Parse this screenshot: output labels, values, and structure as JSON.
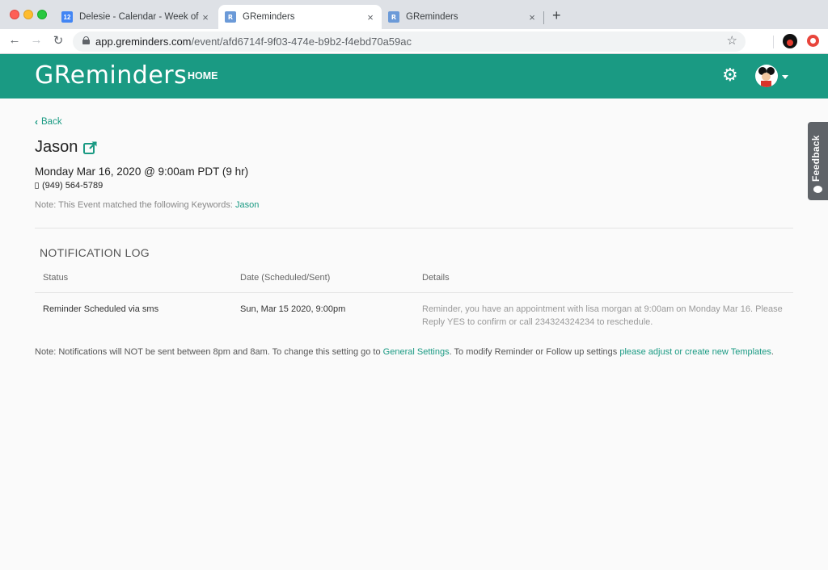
{
  "browser": {
    "tabs": [
      {
        "title": "Delesie - Calendar - Week of Ma",
        "favicon": "calendar-icon",
        "favicon_text": "12",
        "active": false
      },
      {
        "title": "GReminders",
        "favicon": "greminders-icon",
        "favicon_text": "R",
        "active": true
      },
      {
        "title": "GReminders",
        "favicon": "greminders-icon",
        "favicon_text": "R",
        "active": false
      }
    ],
    "new_tab_label": "+",
    "close_glyph": "×",
    "url_host": "app.greminders.com",
    "url_path": "/event/afd6714f-9f03-474e-b9b2-f4ebd70a59ac"
  },
  "header": {
    "brand": "GReminders",
    "nav_home": "HOME",
    "accent_color": "#1a9a83"
  },
  "event": {
    "back_label": "Back",
    "title": "Jason",
    "datetime": "Monday Mar 16, 2020 @ 9:00am PDT (9 hr)",
    "phone": "(949) 564-5789",
    "keywords_note": "Note: This Event matched the following Keywords:",
    "keyword": "Jason"
  },
  "log": {
    "heading": "NOTIFICATION LOG",
    "columns": [
      "Status",
      "Date (Scheduled/Sent)",
      "Details"
    ],
    "rows": [
      {
        "status": "Reminder Scheduled via sms",
        "date": "Sun, Mar 15 2020, 9:00pm",
        "details": "Reminder, you have an appointment with lisa morgan at 9:00am on Monday Mar 16. Please Reply YES to confirm or call 234324324234 to reschedule."
      }
    ]
  },
  "footer": {
    "text1": "Note: Notifications will NOT be sent between 8pm and 8am. To change this setting go to ",
    "link1": "General Settings",
    "text2": ". To modify Reminder or Follow up settings ",
    "link2": "please adjust or create new Templates",
    "text3": "."
  },
  "feedback_label": "Feedback"
}
